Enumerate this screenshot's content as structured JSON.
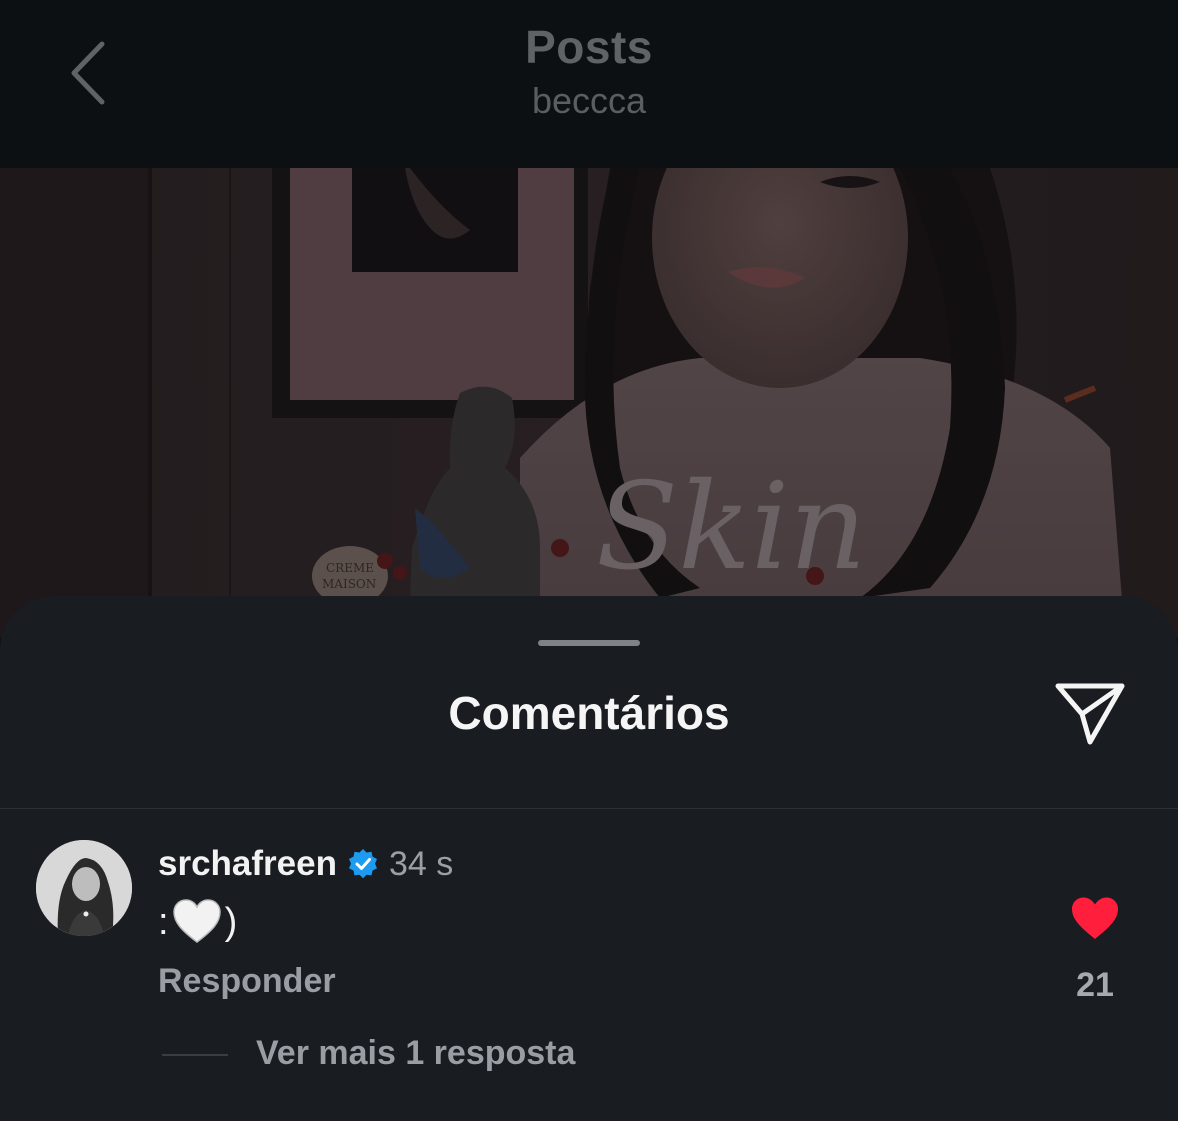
{
  "header": {
    "title": "Posts",
    "subtitle": "beccca",
    "back_icon": "chevron-left-icon"
  },
  "photo": {
    "description_icon": "post-photo",
    "sign_text_1": "CREME",
    "sign_text_2": "MAISON",
    "shirt_text": "Skin"
  },
  "sheet": {
    "title": "Comentários",
    "share_icon": "paper-plane-icon"
  },
  "comment": {
    "username": "srchafreen",
    "verified_icon": "verified-badge-icon",
    "time": "34 s",
    "text_prefix": ":",
    "text_suffix": ")",
    "emoji_icon": "white-heart-emoji",
    "reply_label": "Responder",
    "like_icon": "red-heart-icon",
    "like_count": "21",
    "more_replies_label": "Ver mais 1 resposta"
  },
  "colors": {
    "header_bg": "#0d1012",
    "sheet_bg": "#191c20",
    "like_red": "#ff1f3d",
    "verified_blue": "#1d9bf0"
  }
}
